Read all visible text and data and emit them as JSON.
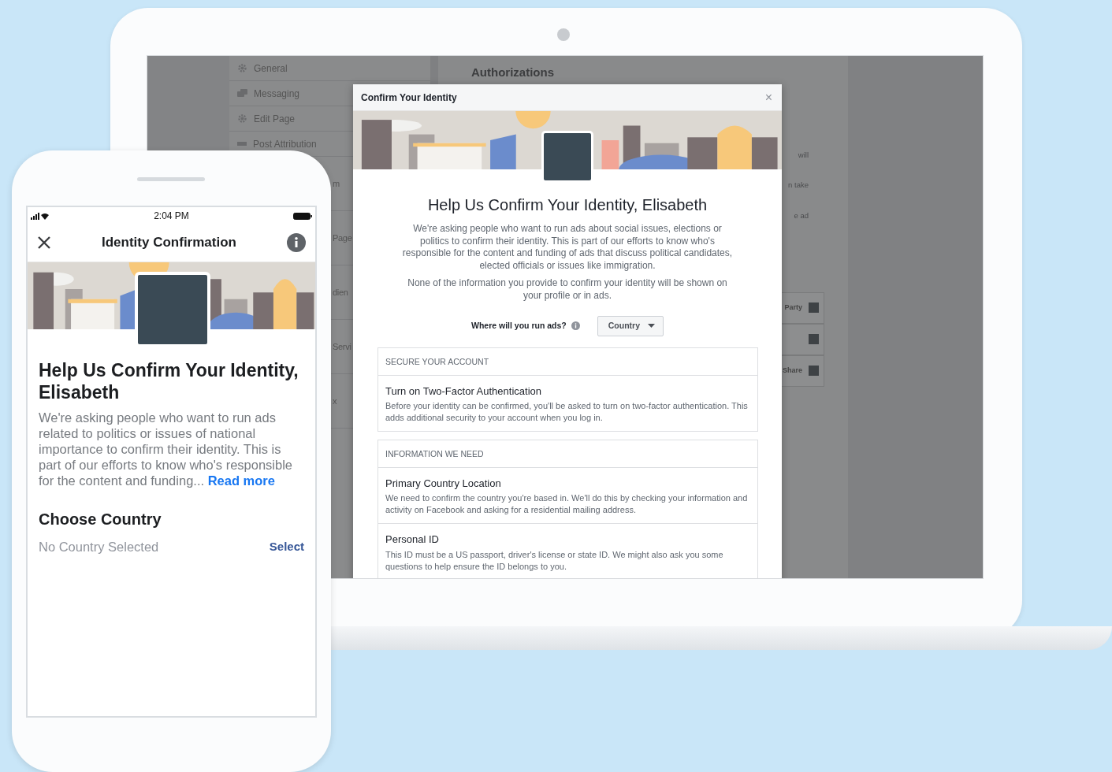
{
  "laptop": {
    "background_page": {
      "sidebar_items": [
        {
          "label": "General",
          "kind": "gear"
        },
        {
          "label": "Messaging",
          "kind": "chat"
        },
        {
          "label": "Edit Page",
          "kind": "gear"
        },
        {
          "label": "Post Attribution",
          "kind": "flag"
        },
        {
          "label": "m",
          "kind": "covered"
        },
        {
          "label": "Page",
          "kind": "covered"
        },
        {
          "label": "dien",
          "kind": "covered"
        },
        {
          "label": "Servi",
          "kind": "covered"
        },
        {
          "label": "x",
          "kind": "covered"
        }
      ],
      "heading": "Authorizations",
      "fragments": [
        "will",
        "n take",
        "e ad"
      ],
      "card_rows": [
        {
          "label": "Party"
        },
        {},
        {
          "label": "Share"
        }
      ]
    },
    "dialog": {
      "title": "Confirm Your Identity",
      "close": "×",
      "heading": "Help Us Confirm Your Identity, Elisabeth",
      "paragraphs": [
        "We're asking people who want to run ads about social issues, elections or politics to confirm their identity. This is part of our efforts to know who's responsible for the content and funding of ads that discuss political candidates, elected officials or issues like immigration.",
        "None of the information you provide to confirm your identity will be shown on your profile or in ads."
      ],
      "question": "Where will you run ads?",
      "dropdown": "Country",
      "sections": [
        {
          "header": "SECURE YOUR ACCOUNT",
          "items": [
            {
              "title": "Turn on Two-Factor Authentication",
              "description": "Before your identity can be confirmed, you'll be asked to turn on two-factor authentication. This adds additional security to your account when you log in."
            }
          ]
        },
        {
          "header": "INFORMATION WE NEED",
          "items": [
            {
              "title": "Primary Country Location",
              "description": "We need to confirm the country you're based in. We'll do this by checking your information and activity on Facebook and asking for a residential mailing address."
            },
            {
              "title": "Personal ID",
              "description": "This ID must be a US passport, driver's license or state ID. We might also ask you some questions to help ensure the ID belongs to you."
            }
          ]
        }
      ]
    }
  },
  "phone": {
    "status_bar": {
      "time": "2:04 PM"
    },
    "nav": {
      "title": "Identity Confirmation"
    },
    "heading": "Help Us Confirm Your Identity, Elisabeth",
    "description": "We're asking people who want to run ads related to politics or issues of national importance to confirm their identity. This is part of our efforts to know who's responsible for the content and funding...",
    "read_more": "Read more",
    "section_title": "Choose Country",
    "country_value": "No Country Selected",
    "select": "Select"
  }
}
